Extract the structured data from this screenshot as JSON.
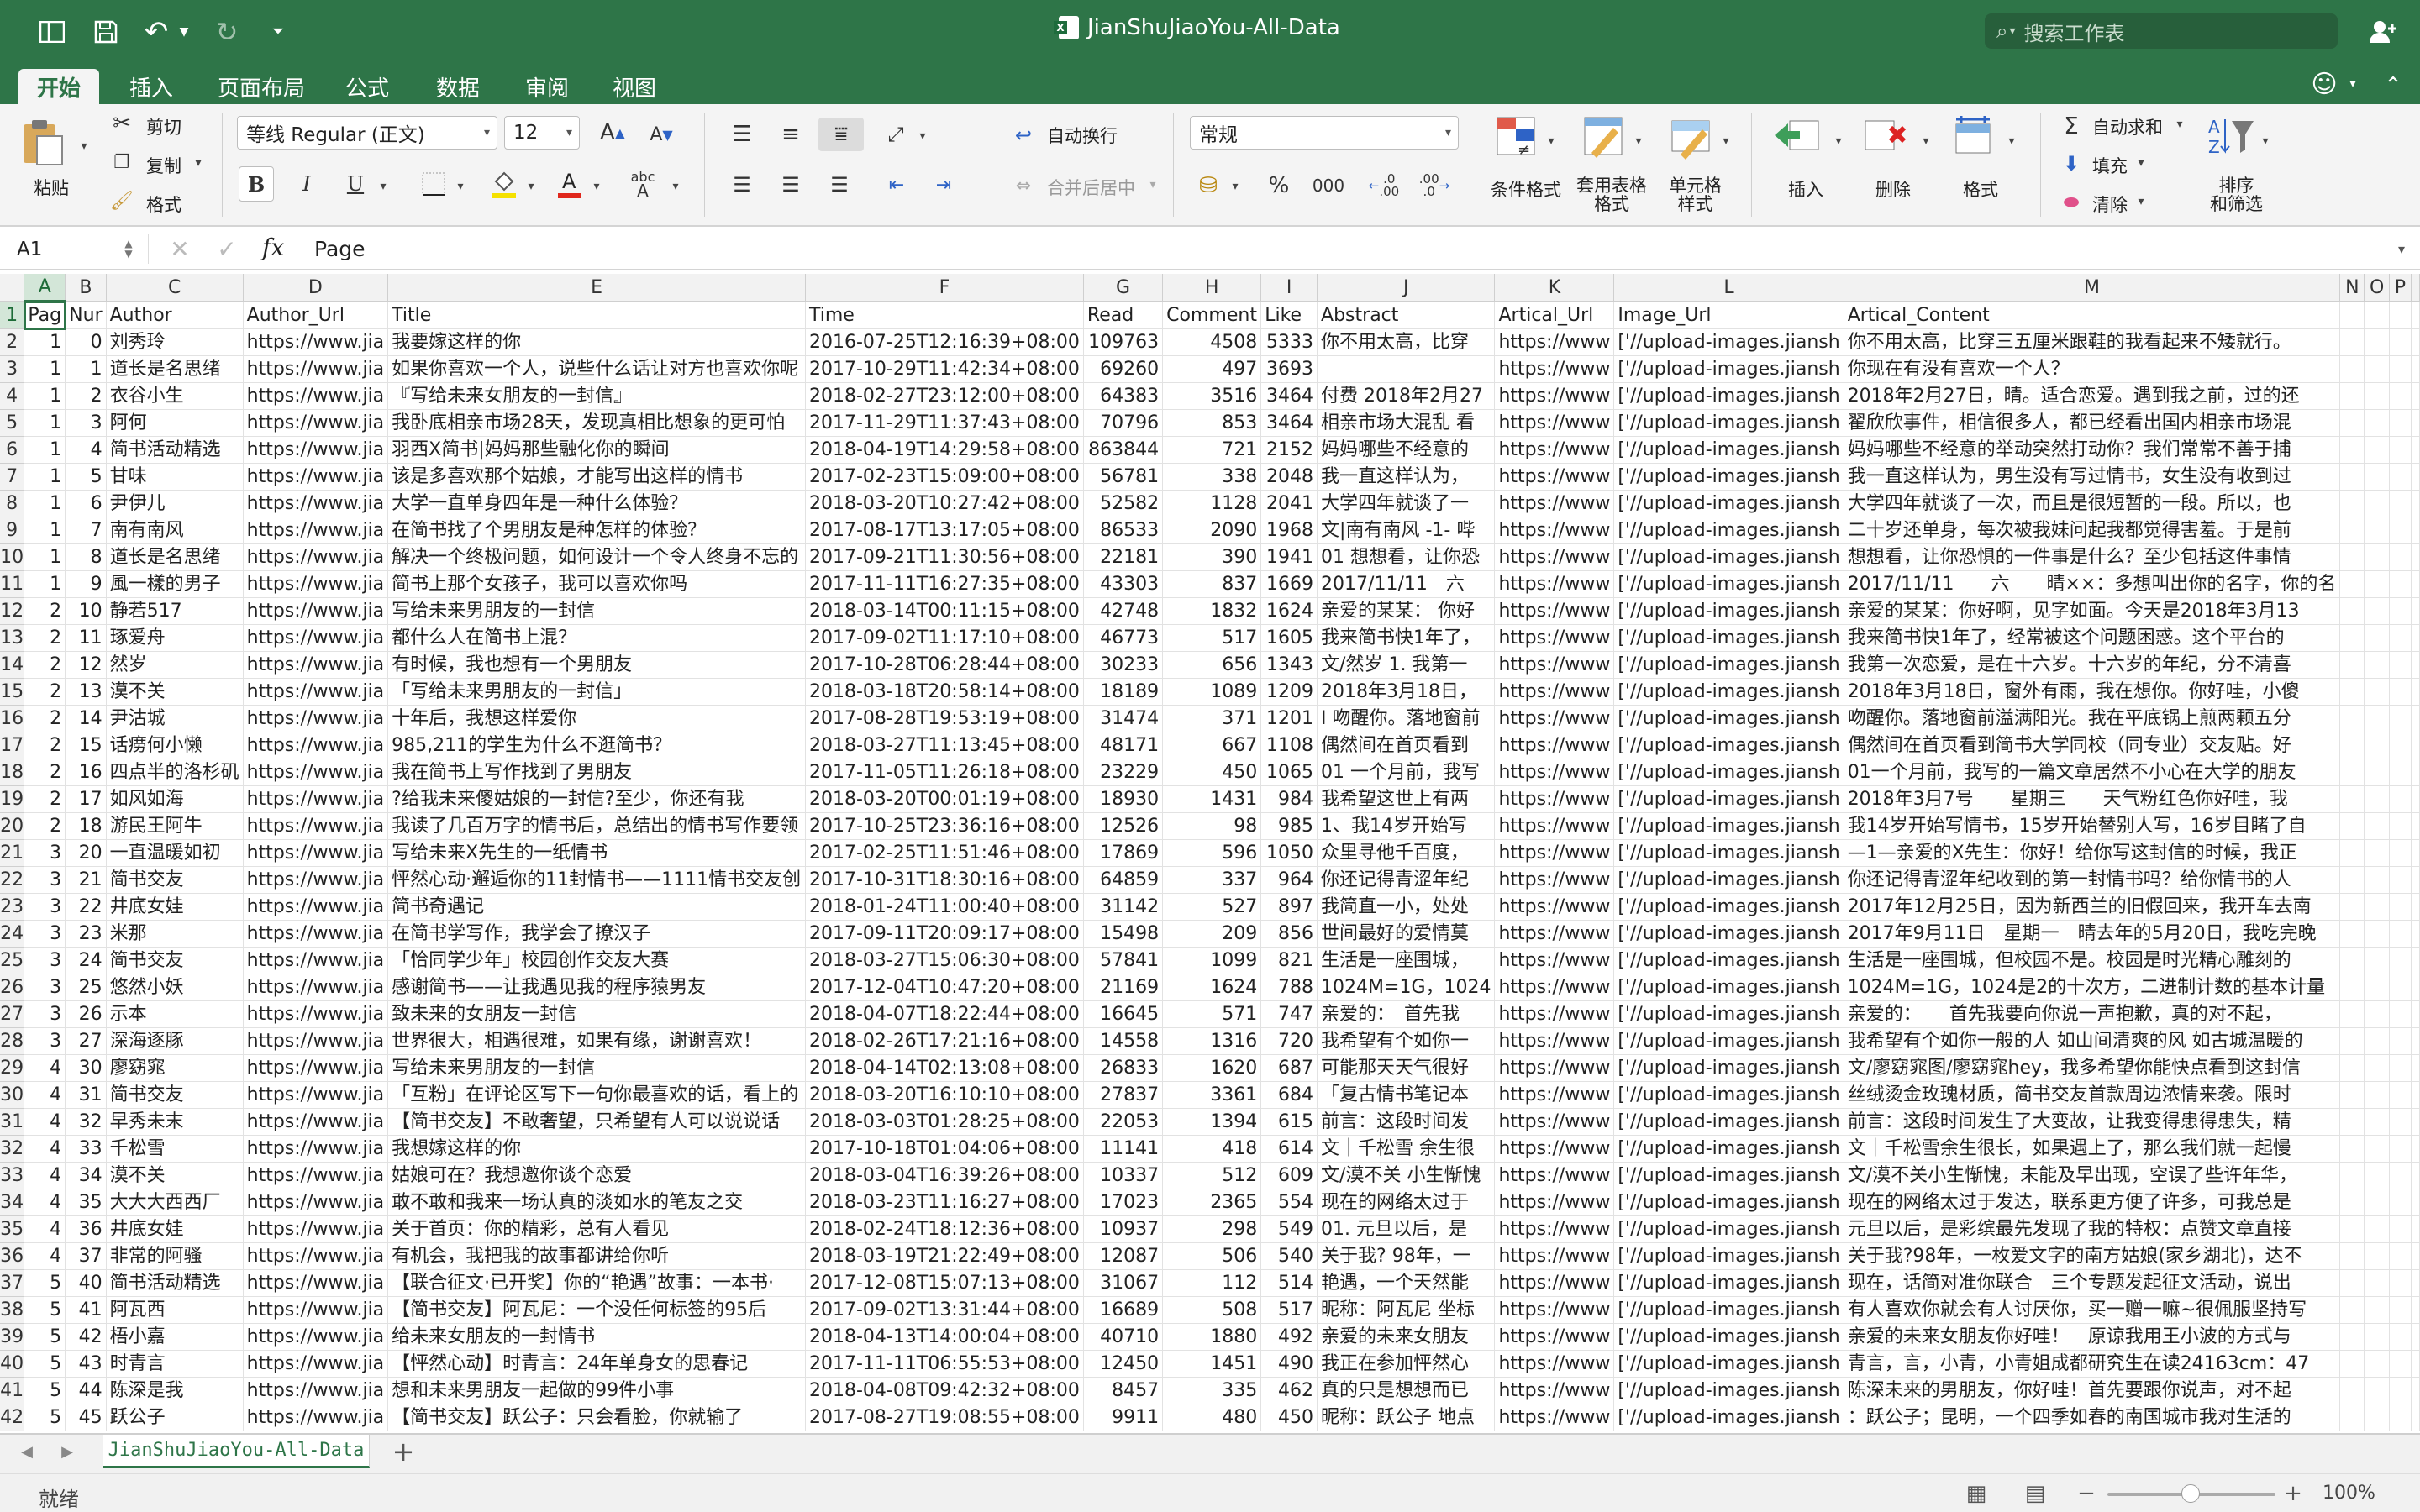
{
  "titlebar": {
    "doc_title": "JianShuJiaoYou-All-Data",
    "search_placeholder": "搜索工作表"
  },
  "tabs": [
    "开始",
    "插入",
    "页面布局",
    "公式",
    "数据",
    "审阅",
    "视图"
  ],
  "ribbon": {
    "paste": "粘贴",
    "cut": "剪切",
    "copy": "复制",
    "format_painter": "格式",
    "font_name": "等线 Regular (正文)",
    "font_size": "12",
    "wrap_text": "自动换行",
    "merge_center": "合并后居中",
    "number_format": "常规",
    "percent": "%",
    "thousands": "000",
    "decimal_inc": ".0\n.00",
    "decimal_dec": ".00\n.0",
    "conditional_format": "条件格式",
    "table_format": "套用表格\n格式",
    "cell_style": "单元格\n样式",
    "insert": "插入",
    "delete": "删除",
    "format": "格式",
    "autosum": "自动求和",
    "fill": "填充",
    "clear": "清除",
    "sort_filter": "排序\n和筛选"
  },
  "formula_bar": {
    "name_box": "A1",
    "fx": "fx",
    "formula": "Page"
  },
  "columns": [
    "A",
    "B",
    "C",
    "D",
    "E",
    "F",
    "G",
    "H",
    "I",
    "J",
    "K",
    "L",
    "M",
    "N",
    "O",
    "P"
  ],
  "header_row": [
    "Pag",
    "Nur",
    "Author",
    "Author_Url",
    "Title",
    "Time",
    "Read",
    "Comment",
    "Like",
    "Abstract",
    "Artical_Url",
    "Image_Url",
    "Artical_Content",
    "",
    "",
    ""
  ],
  "rows": [
    [
      "1",
      "0",
      "刘秀玲",
      "https://www.jia",
      "我要嫁这样的你",
      "2016-07-25T12:16:39+08:00",
      "109763",
      "4508",
      "5333",
      "你不用太高，比穿",
      "https://www",
      "['//upload-images.jiansh",
      "你不用太高，比穿三五厘米跟鞋的我看起来不矮就行。"
    ],
    [
      "1",
      "1",
      "道长是名思绪",
      "https://www.jia",
      "如果你喜欢一个人，说些什么话让对方也喜欢你呢",
      "2017-10-29T11:42:34+08:00",
      "69260",
      "497",
      "3693",
      "",
      "https://www",
      "['//upload-images.jiansh",
      "你现在有没有喜欢一个人？"
    ],
    [
      "1",
      "2",
      "衣谷小生",
      "https://www.jia",
      "『写给未来女朋友的一封信』",
      "2018-02-27T23:12:00+08:00",
      "64383",
      "3516",
      "3464",
      "付费 2018年2月27",
      "https://www",
      "['//upload-images.jiansh",
      "2018年2月27日，晴。适合恋爱。遇到我之前，过的还"
    ],
    [
      "1",
      "3",
      "阿何",
      "https://www.jia",
      "我卧底相亲市场28天，发现真相比想象的更可怕",
      "2017-11-29T11:37:43+08:00",
      "70796",
      "853",
      "3464",
      "相亲市场大混乱 看",
      "https://www",
      "['//upload-images.jiansh",
      "翟欣欣事件，相信很多人，都已经看出国内相亲市场混"
    ],
    [
      "1",
      "4",
      "简书活动精选",
      "https://www.jia",
      "羽西X简书|妈妈那些融化你的瞬间",
      "2018-04-19T14:29:58+08:00",
      "863844",
      "721",
      "2152",
      "妈妈哪些不经意的",
      "https://www",
      "['//upload-images.jiansh",
      "妈妈哪些不经意的举动突然打动你？我们常常不善于捕"
    ],
    [
      "1",
      "5",
      "甘味",
      "https://www.jia",
      "该是多喜欢那个姑娘，才能写出这样的情书",
      "2017-02-23T15:09:00+08:00",
      "56781",
      "338",
      "2048",
      "我一直这样认为，",
      "https://www",
      "['//upload-images.jiansh",
      "我一直这样认为，男生没有写过情书，女生没有收到过"
    ],
    [
      "1",
      "6",
      "尹伊儿",
      "https://www.jia",
      "大学一直单身四年是一种什么体验？",
      "2018-03-20T10:27:42+08:00",
      "52582",
      "1128",
      "2041",
      "大学四年就谈了一",
      "https://www",
      "['//upload-images.jiansh",
      "大学四年就谈了一次，而且是很短暂的一段。所以，也"
    ],
    [
      "1",
      "7",
      "南有南风",
      "https://www.jia",
      "在简书找了个男朋友是种怎样的体验？",
      "2017-08-17T13:17:05+08:00",
      "86533",
      "2090",
      "1968",
      "文|南有南风 -1- 哔",
      "https://www",
      "['//upload-images.jiansh",
      "二十岁还单身，每次被我妹问起我都觉得害羞。于是前"
    ],
    [
      "1",
      "8",
      "道长是名思绪",
      "https://www.jia",
      "解决一个终极问题，如何设计一个令人终身不忘的",
      "2017-09-21T11:30:56+08:00",
      "22181",
      "390",
      "1941",
      "01 想想看，让你恐",
      "https://www",
      "['//upload-images.jiansh",
      "想想看，让你恐惧的一件事是什么？至少包括这件事情"
    ],
    [
      "1",
      "9",
      "風一樣的男子",
      "https://www.jia",
      "简书上那个女孩子，我可以喜欢你吗",
      "2017-11-11T16:27:35+08:00",
      "43303",
      "837",
      "1669",
      "2017/11/11　六",
      "https://www",
      "['//upload-images.jiansh",
      "2017/11/11　　六　　晴××：多想叫出你的名字，你的名"
    ],
    [
      "2",
      "10",
      "静若517",
      "https://www.jia",
      "写给未来男朋友的一封信",
      "2018-03-14T00:11:15+08:00",
      "42748",
      "1832",
      "1624",
      "亲爱的某某： 你好",
      "https://www",
      "['//upload-images.jiansh",
      "亲爱的某某：你好啊，见字如面。今天是2018年3月13"
    ],
    [
      "2",
      "11",
      "琢爱舟",
      "https://www.jia",
      "都什么人在简书上混？",
      "2017-09-02T11:17:10+08:00",
      "46773",
      "517",
      "1605",
      "我来简书快1年了，",
      "https://www",
      "['//upload-images.jiansh",
      "我来简书快1年了，经常被这个问题困惑。这个平台的"
    ],
    [
      "2",
      "12",
      "然岁",
      "https://www.jia",
      "有时候，我也想有一个男朋友",
      "2017-10-28T06:28:44+08:00",
      "30233",
      "656",
      "1343",
      "文/然岁 1. 我第一",
      "https://www",
      "['//upload-images.jiansh",
      "我第一次恋爱，是在十六岁。十六岁的年纪，分不清喜"
    ],
    [
      "2",
      "13",
      "漠不关",
      "https://www.jia",
      "「写给未来男朋友的一封信」",
      "2018-03-18T20:58:14+08:00",
      "18189",
      "1089",
      "1209",
      "2018年3月18日，",
      "https://www",
      "['//upload-images.jiansh",
      "2018年3月18日，窗外有雨，我在想你。你好哇，小傻"
    ],
    [
      "2",
      "14",
      "尹沽城",
      "https://www.jia",
      "十年后，我想这样爱你",
      "2017-08-28T19:53:19+08:00",
      "31474",
      "371",
      "1201",
      "I 吻醒你。落地窗前",
      "https://www",
      "['//upload-images.jiansh",
      "吻醒你。落地窗前溢满阳光。我在平底锅上煎两颗五分"
    ],
    [
      "2",
      "15",
      "话痨何小懒",
      "https://www.jia",
      "985,211的学生为什么不逛简书？",
      "2018-03-27T11:13:45+08:00",
      "48171",
      "667",
      "1108",
      "偶然间在首页看到",
      "https://www",
      "['//upload-images.jiansh",
      "偶然间在首页看到简书大学同校（同专业）交友贴。好"
    ],
    [
      "2",
      "16",
      "四点半的洛杉矶",
      "https://www.jia",
      "我在简书上写作找到了男朋友",
      "2017-11-05T11:26:18+08:00",
      "23229",
      "450",
      "1065",
      "01 一个月前，我写",
      "https://www",
      "['//upload-images.jiansh",
      "01一个月前，我写的一篇文章居然不小心在大学的朋友"
    ],
    [
      "2",
      "17",
      "如风如海",
      "https://www.jia",
      "?给我未来傻姑娘的一封信?至少，你还有我",
      "2018-03-20T00:01:19+08:00",
      "18930",
      "1431",
      "984",
      "我希望这世上有两",
      "https://www",
      "['//upload-images.jiansh",
      "2018年3月7号　　星期三　　天气粉红色你好哇，我"
    ],
    [
      "2",
      "18",
      "游民王阿牛",
      "https://www.jia",
      "我读了几百万字的情书后，总结出的情书写作要领",
      "2017-10-25T23:36:16+08:00",
      "12526",
      "98",
      "985",
      "1、我14岁开始写",
      "https://www",
      "['//upload-images.jiansh",
      "我14岁开始写情书，15岁开始替别人写，16岁目睹了自"
    ],
    [
      "3",
      "20",
      "一直温暖如初",
      "https://www.jia",
      "写给未来X先生的一纸情书",
      "2017-02-25T11:51:46+08:00",
      "17869",
      "596",
      "1050",
      "众里寻他千百度，",
      "https://www",
      "['//upload-images.jiansh",
      "—1—亲爱的X先生：你好！给你写这封信的时候，我正"
    ],
    [
      "3",
      "21",
      "简书交友",
      "https://www.jia",
      "怦然心动·邂逅你的11封情书——1111情书交友创",
      "2017-10-31T18:30:16+08:00",
      "64859",
      "337",
      "964",
      "你还记得青涩年纪",
      "https://www",
      "['//upload-images.jiansh",
      "你还记得青涩年纪收到的第一封情书吗？给你情书的人"
    ],
    [
      "3",
      "22",
      "井底女娃",
      "https://www.jia",
      "简书奇遇记",
      "2018-01-24T11:00:40+08:00",
      "31142",
      "527",
      "897",
      "我简直一小，处处",
      "https://www",
      "['//upload-images.jiansh",
      "2017年12月25日，因为新西兰的旧假回来，我开车去南"
    ],
    [
      "3",
      "23",
      "米那",
      "https://www.jia",
      "在简书学写作，我学会了撩汉子",
      "2017-09-11T20:09:17+08:00",
      "15498",
      "209",
      "856",
      "世间最好的爱情莫",
      "https://www",
      "['//upload-images.jiansh",
      "2017年9月11日　星期一　晴去年的5月20日，我吃完晚"
    ],
    [
      "3",
      "24",
      "简书交友",
      "https://www.jia",
      "「恰同学少年」校园创作交友大赛",
      "2018-03-27T15:06:30+08:00",
      "57841",
      "1099",
      "821",
      "生活是一座围城，",
      "https://www",
      "['//upload-images.jiansh",
      "生活是一座围城，但校园不是。校园是时光精心雕刻的"
    ],
    [
      "3",
      "25",
      "悠然小妖",
      "https://www.jia",
      "感谢简书——让我遇见我的程序猿男友",
      "2017-12-04T10:47:20+08:00",
      "21169",
      "1624",
      "788",
      "1024M=1G，1024",
      "https://www",
      "['//upload-images.jiansh",
      "1024M=1G，1024是2的十次方，二进制计数的基本计量"
    ],
    [
      "3",
      "26",
      "示本",
      "https://www.jia",
      "致未来的女朋友一封信",
      "2018-04-07T18:22:44+08:00",
      "16645",
      "571",
      "747",
      "亲爱的：　首先我",
      "https://www",
      "['//upload-images.jiansh",
      "亲爱的：　　首先我要向你说一声抱歉，真的对不起，"
    ],
    [
      "3",
      "27",
      "深海逐豚",
      "https://www.jia",
      "世界很大，相遇很难，如果有缘，谢谢喜欢！",
      "2018-02-26T17:21:16+08:00",
      "14558",
      "1316",
      "720",
      "我希望有个如你一",
      "https://www",
      "['//upload-images.jiansh",
      "我希望有个如你一般的人 如山间清爽的风 如古城温暖的"
    ],
    [
      "4",
      "30",
      "廖窈窕",
      "https://www.jia",
      "写给未来男朋友的一封信",
      "2018-04-14T02:13:08+08:00",
      "26833",
      "1620",
      "687",
      "可能那天天气很好",
      "https://www",
      "['//upload-images.jiansh",
      "文/廖窈窕图/廖窈窕hey，我多希望你能快点看到这封信"
    ],
    [
      "4",
      "31",
      "简书交友",
      "https://www.jia",
      "「互粉」在评论区写下一句你最喜欢的话，看上的",
      "2018-03-20T16:10:10+08:00",
      "27837",
      "3361",
      "684",
      "「复古情书笔记本",
      "https://www",
      "['//upload-images.jiansh",
      "丝绒烫金玫瑰材质，简书交友首款周边浓情来袭。限时"
    ],
    [
      "4",
      "32",
      "早秀未末",
      "https://www.jia",
      "【简书交友】不敢奢望，只希望有人可以说说话",
      "2018-03-03T01:28:25+08:00",
      "22053",
      "1394",
      "615",
      "前言：这段时间发",
      "https://www",
      "['//upload-images.jiansh",
      "前言：这段时间发生了大变故，让我变得患得患失，精"
    ],
    [
      "4",
      "33",
      "千松雪",
      "https://www.jia",
      "我想嫁这样的你",
      "2017-10-18T01:04:06+08:00",
      "11141",
      "418",
      "614",
      "文｜千松雪 余生很",
      "https://www",
      "['//upload-images.jiansh",
      "文｜千松雪余生很长，如果遇上了，那么我们就一起慢"
    ],
    [
      "4",
      "34",
      "漠不关",
      "https://www.jia",
      "姑娘可在？我想邀你谈个恋爱",
      "2018-03-04T16:39:26+08:00",
      "10337",
      "512",
      "609",
      "文/漠不关 小生惭愧",
      "https://www",
      "['//upload-images.jiansh",
      "文/漠不关小生惭愧，未能及早出现，空误了些许年华，"
    ],
    [
      "4",
      "35",
      "大大大西西厂",
      "https://www.jia",
      "敢不敢和我来一场认真的淡如水的笔友之交",
      "2018-03-23T11:16:27+08:00",
      "17023",
      "2365",
      "554",
      "现在的网络太过于",
      "https://www",
      "['//upload-images.jiansh",
      "现在的网络太过于发达，联系更方便了许多，可我总是"
    ],
    [
      "4",
      "36",
      "井底女娃",
      "https://www.jia",
      "关于首页：你的精彩，总有人看见",
      "2018-02-24T18:12:36+08:00",
      "10937",
      "298",
      "549",
      "01. 元旦以后，是",
      "https://www",
      "['//upload-images.jiansh",
      "元旦以后，是彩缤最先发现了我的特权：点赞文章直接"
    ],
    [
      "4",
      "37",
      "非常的阿骚",
      "https://www.jia",
      "有机会，我把我的故事都讲给你听",
      "2018-03-19T21:22:49+08:00",
      "12087",
      "506",
      "540",
      "关于我? 98年，一",
      "https://www",
      "['//upload-images.jiansh",
      "关于我?98年，一枚爱文字的南方姑娘(家乡湖北)，达不"
    ],
    [
      "5",
      "40",
      "简书活动精选",
      "https://www.jia",
      "【联合征文·已开奖】你的“艳遇”故事：一本书·",
      "2017-12-08T15:07:13+08:00",
      "31067",
      "112",
      "514",
      "艳遇，一个天然能",
      "https://www",
      "['//upload-images.jiansh",
      "现在，话简对准你联合　三个专题发起征文活动，说出"
    ],
    [
      "5",
      "41",
      "阿瓦西",
      "https://www.jia",
      "【简书交友】阿瓦尼：一个没任何标签的95后",
      "2017-09-02T13:31:44+08:00",
      "16689",
      "508",
      "517",
      "昵称：阿瓦尼 坐标",
      "https://www",
      "['//upload-images.jiansh",
      "有人喜欢你就会有人讨厌你，买一赠一嘛~很佩服坚持写"
    ],
    [
      "5",
      "42",
      "梧小嘉",
      "https://www.jia",
      "给未来女朋友的一封情书",
      "2018-04-13T14:00:04+08:00",
      "40710",
      "1880",
      "492",
      "亲爱的未来女朋友",
      "https://www",
      "['//upload-images.jiansh",
      "亲爱的未来女朋友你好哇！　原谅我用王小波的方式与"
    ],
    [
      "5",
      "43",
      "时青言",
      "https://www.jia",
      "【怦然心动】时青言：24年单身女的思春记",
      "2017-11-11T06:55:53+08:00",
      "12450",
      "1451",
      "490",
      "我正在参加怦然心",
      "https://www",
      "['//upload-images.jiansh",
      "青言，言，小青，小青姐成都研究生在读24163cm：47"
    ],
    [
      "5",
      "44",
      "陈深是我",
      "https://www.jia",
      "想和未来男朋友一起做的99件小事",
      "2018-04-08T09:42:32+08:00",
      "8457",
      "335",
      "462",
      "真的只是想想而已",
      "https://www",
      "['//upload-images.jiansh",
      "陈深未来的男朋友，你好哇！首先要跟你说声，对不起"
    ],
    [
      "5",
      "45",
      "跃公子",
      "https://www.jia",
      "【简书交友】跃公子：只会看脸，你就输了",
      "2017-08-27T19:08:55+08:00",
      "9911",
      "480",
      "450",
      "昵称：跃公子 地点",
      "https://www",
      "['//upload-images.jiansh",
      "：跃公子；昆明，一个四季如春的南国城市我对生活的"
    ]
  ],
  "sheet_tab": "JianShuJiaoYou-All-Data",
  "status": {
    "ready": "就绪",
    "zoom": "100%"
  }
}
